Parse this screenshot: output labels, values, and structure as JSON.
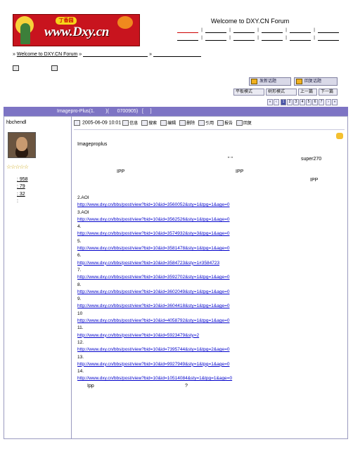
{
  "header": {
    "welcome": "Welcome to DXY.CN Forum",
    "logo_text": "www.Dxy.cn",
    "logo_badge": "丁香园"
  },
  "breadcrumb": {
    "prefix": "»",
    "home": "Welcome to DXY.CN Forum",
    "sep": "»",
    "sep2": "»"
  },
  "toolbar": {
    "new_topic": "发新话题",
    "reply": "回复话题",
    "flat_mode": "平板模式",
    "tree_mode": "树形模式",
    "prev": "上一篇",
    "next": "下一篇"
  },
  "pager": {
    "pages": [
      "1",
      "2",
      "3",
      "4",
      "5",
      "6",
      "7"
    ],
    "current": "1"
  },
  "thread": {
    "title": "Imagepro-Plus(1.        )(      0700905)   [     ]"
  },
  "author": {
    "name": "hbchendl",
    "stars": "☆☆☆☆☆",
    "stats": [
      ": 958",
      ": 79",
      ": 32",
      ":"
    ]
  },
  "post": {
    "date": "2005-06-09 10:01",
    "tools": [
      "信息",
      "搜索",
      "编辑",
      "删除",
      "引用",
      "报告",
      "回复"
    ],
    "lines": {
      "title": "Imageproplus",
      "quote": "\"      \"",
      "user": "super270",
      "ipp1": "IPP",
      "ipp2": "IPP",
      "ipp3": "IPP"
    },
    "links": [
      {
        "label": "2.AOI",
        "url": "http://www.dxy.cn/bbs/post/view?bid=10&id=3560052&sty=1&tpg=1&age=0"
      },
      {
        "label": "3.AOI",
        "url": "http://www.dxy.cn/bbs/post/view?bid=10&id=3562526&sty=1&tpg=1&age=0"
      },
      {
        "label": "4.",
        "url": "http://www.dxy.cn/bbs/post/view?bid=10&id=3574932&sty=3&tpg=1&age=0"
      },
      {
        "label": "5.",
        "url": "http://www.dxy.cn/bbs/post/view?bid=10&id=3581478&sty=1&tpg=1&age=0"
      },
      {
        "label": "6.",
        "url": "http://www.dxy.cn/bbs/post/view?bid=10&id=3584723&sty=1#3584723"
      },
      {
        "label": "7.",
        "url": "http://www.dxy.cn/bbs/post/view?bid=10&id=3592702&sty=1&tpg=1&age=0"
      },
      {
        "label": "8.",
        "url": "http://www.dxy.cn/bbs/post/view?bid=10&id=3602049&sty=1&tpg=1&age=0"
      },
      {
        "label": "9.",
        "url": "http://www.dxy.cn/bbs/post/view?bid=10&id=3604418&sty=1&tpg=1&age=0"
      },
      {
        "label": "10",
        "url": "http://www.dxy.cn/bbs/post/view?bid=10&id=4058792&sty=1&tpg=1&age=0"
      },
      {
        "label": "11.",
        "url": "http://www.dxy.cn/bbs/post/view?bid=10&id=5923479&sty=2"
      },
      {
        "label": "12.",
        "url": "http://www.dxy.cn/bbs/post/view?bid=10&id=7395744&sty=1&tpg=2&age=0"
      },
      {
        "label": "13.",
        "url": "http://www.dxy.cn/bbs/post/view?bid=10&id=9927949&sty=1&tpg=1&age=0"
      },
      {
        "label": "14.",
        "url": "http://www.dxy.cn/bbs/post/view?bid=10&id=10514084&sty=1&tpg=1&age=0"
      }
    ],
    "footer_a": "Ipp",
    "footer_b": "?"
  },
  "colors": {
    "titlebar": "#7d74c4",
    "link": "#0000cc"
  }
}
